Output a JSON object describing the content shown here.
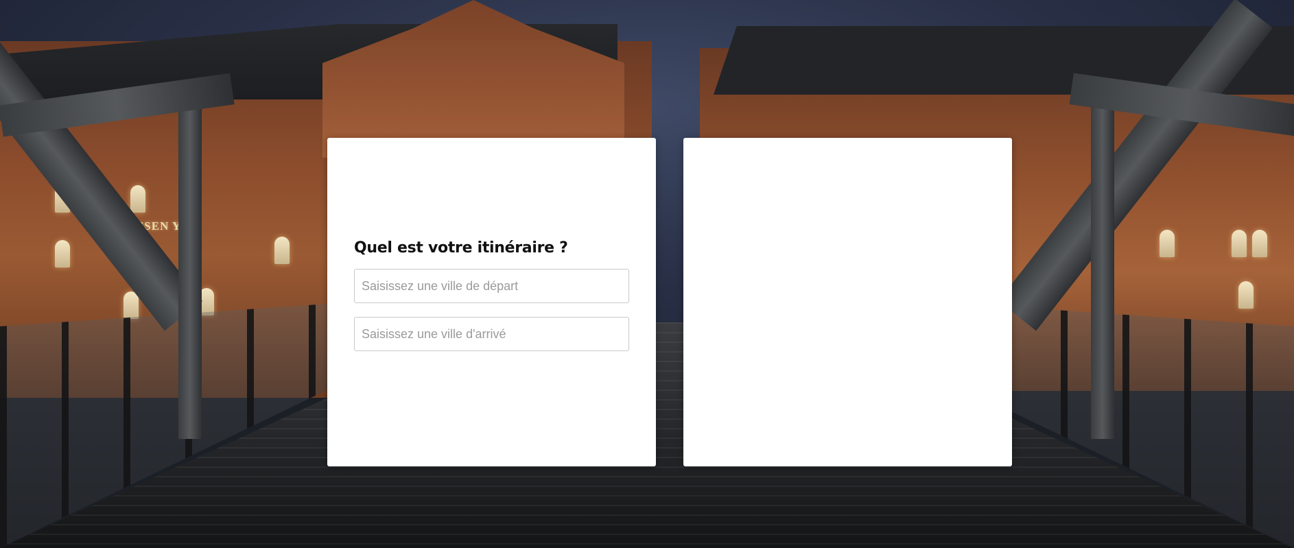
{
  "background": {
    "sign_text": "HALSSEN    YO"
  },
  "itinerary": {
    "title": "Quel est votre itinéraire ?",
    "departure": {
      "value": "",
      "placeholder": "Saisissez une ville de départ"
    },
    "arrival": {
      "value": "",
      "placeholder": "Saisissez une ville d'arrivé"
    }
  },
  "results_panel": {}
}
